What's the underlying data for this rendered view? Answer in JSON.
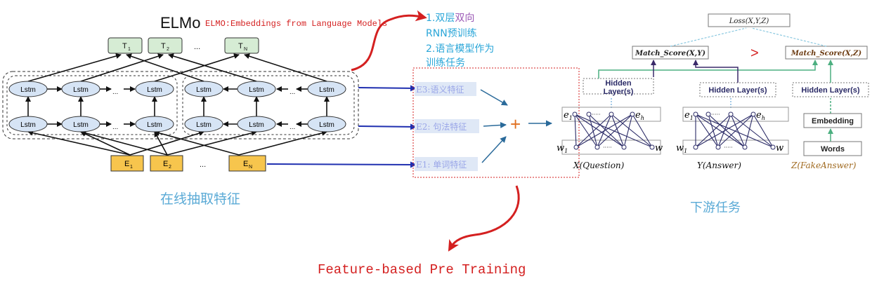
{
  "elmo": {
    "title": "ELMo",
    "subtitle": "ELMO:Embeddings from Language Models",
    "lstm_label": "Lstm",
    "dots": "...",
    "outputs": {
      "t1": "T",
      "t1_sub": "1",
      "t2": "T",
      "t2_sub": "2",
      "tn": "T",
      "tn_sub": "N"
    },
    "inputs": {
      "e1": "E",
      "e1_sub": "1",
      "e2": "E",
      "e2_sub": "2",
      "en": "E",
      "en_sub": "N"
    },
    "caption": "在线抽取特征"
  },
  "note": {
    "line1_a": "1.双层",
    "line1_b": "双向",
    "line2": "RNN预训练",
    "line3": "2.语言模型作为",
    "line4": "训练任务"
  },
  "features": {
    "e3": "E3:语义特征",
    "e2": "E2: 句法特征",
    "e1": "E1: 单词特征",
    "plus": "+"
  },
  "downstream": {
    "loss": "Loss(X,Y,Z)",
    "match_xy": "Match_Score(X,Y)",
    "match_xz": "Match_Score(X,Z)",
    "gt": ">",
    "hidden1_l1": "Hidden",
    "hidden1_l2": "Layer(s)",
    "hidden2": "Hidden Layer(s)",
    "hidden3": "Hidden Layer(s)",
    "embedding": "Embedding",
    "words": "Words",
    "e_1": "e",
    "e_1_sub": "1",
    "e_h": "e",
    "e_h_sub": "h",
    "w_1": "w",
    "w_1_sub": "1",
    "w": "w",
    "ellipsis": "·····",
    "x_label": "X(Question)",
    "y_label": "Y(Answer)",
    "z_label": "Z(FakeAnswer)",
    "caption": "下游任务"
  },
  "footer": "Feature-based Pre Training",
  "colors": {
    "red": "#d42020",
    "note_blue": "#2aa6d8",
    "note_purple": "#9b59b6",
    "feature_text": "#9aa6e8",
    "feature_bg": "#dfe8f6",
    "arrow_blue": "#1f2fb0",
    "lstm_fill": "#d6e4f5",
    "t_fill": "#d6ecd4",
    "e_fill": "#f7c54d",
    "green": "#4caf80",
    "purple": "#3a2a6a",
    "orange": "#e07020",
    "caption_blue": "#5aaad6"
  }
}
